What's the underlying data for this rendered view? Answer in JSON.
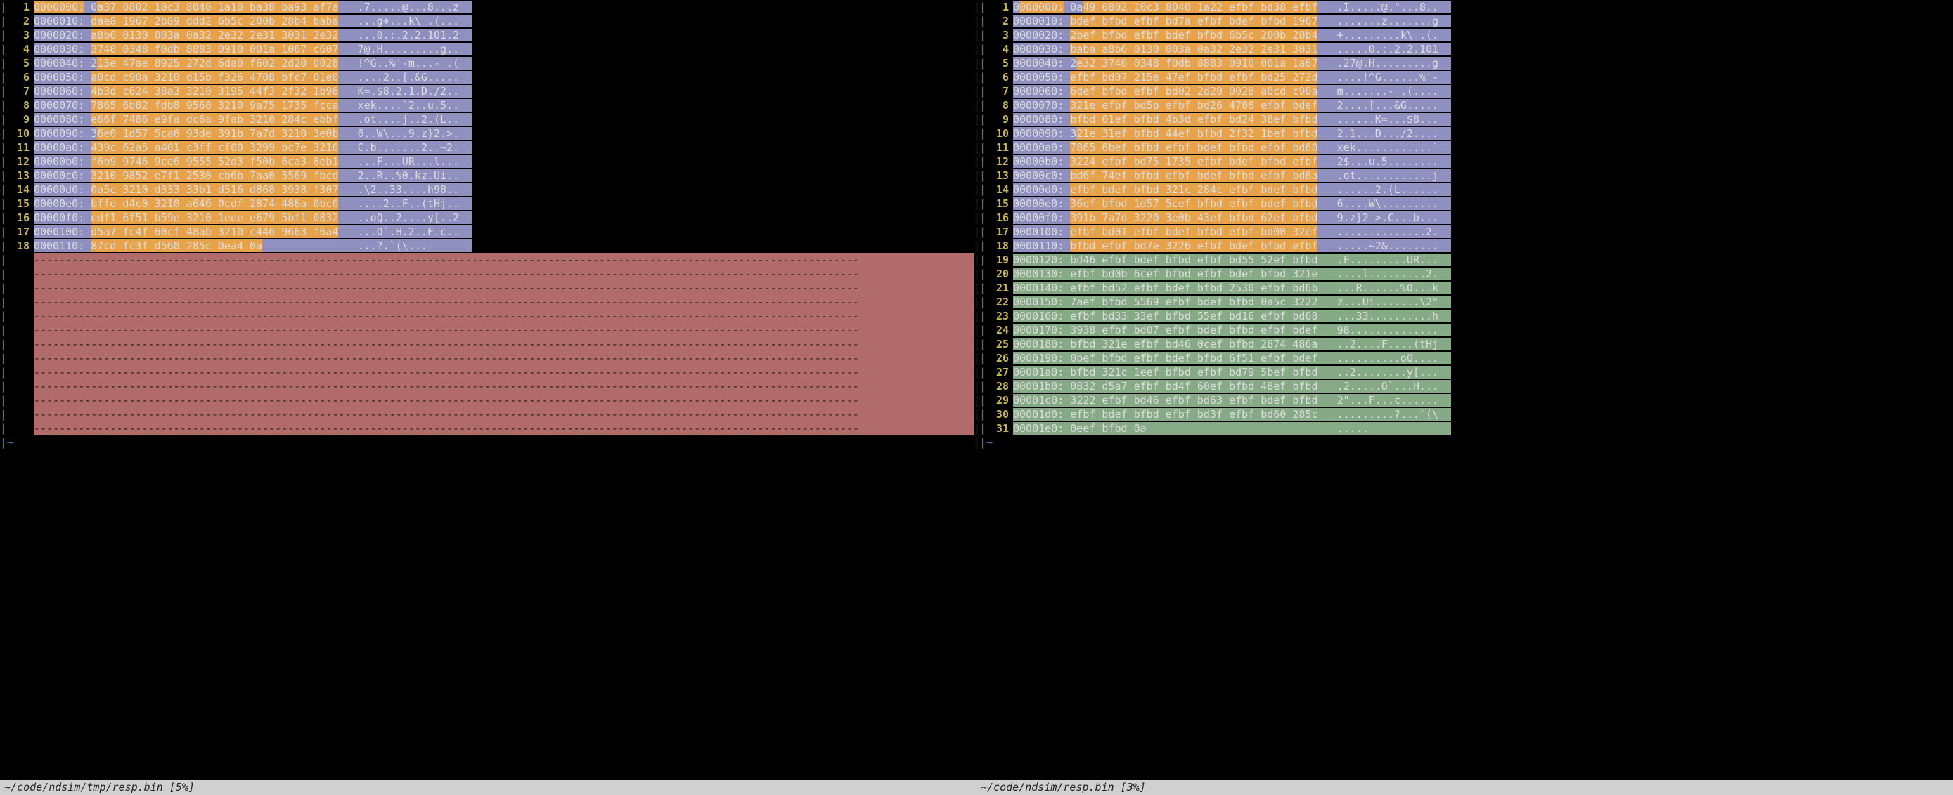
{
  "status": {
    "left": "~/code/ndsim/tmp/resp.bin [5%]",
    "right": "~/code/ndsim/resp.bin [3%]"
  },
  "left": {
    "rows": [
      {
        "n": 1,
        "addr": "0000000:",
        "hex": "0a37 0802 10c3 8040 1a10 ba38 ba93 af7a",
        "ascii": ".7.....@...8...z",
        "addrbg": "orange",
        "hexseg": [
          {
            "t": "0",
            "bg": "purple"
          },
          {
            "t": "a37 0802 10c3 8040 1a10 ba38 ba93 af7a",
            "bg": "orange"
          }
        ],
        "asciibg": "purple"
      },
      {
        "n": 2,
        "addr": "0000010:",
        "hex": "dae8 1967 2b89 ddd2 6b5c 200b 28b4 baba",
        "ascii": "...g+...k\\ .(...",
        "addrbg": "purple",
        "hexbg": "orange",
        "asciibg": "purple"
      },
      {
        "n": 3,
        "addr": "0000020:",
        "hex": "a8b6 0130 003a 0a32 2e32 2e31 3031 2e32",
        "ascii": "...0.:.2.2.101.2",
        "addrbg": "purple",
        "hexbg": "orange",
        "asciibg": "purple"
      },
      {
        "n": 4,
        "addr": "0000030:",
        "hex": "3740 0348 f0db 8883 0910 001a 1067 c607",
        "ascii": "7@.H.........g..",
        "addrbg": "purple",
        "hexbg": "orange",
        "asciibg": "purple"
      },
      {
        "n": 5,
        "addr": "0000040:",
        "hex": "215e 47ae 8925 272d 6da0 f602 2d20 0028",
        "ascii": "!^G..%'-m...- .(",
        "addrbg": "purple",
        "hexseg": [
          {
            "t": "2",
            "bg": "purple"
          },
          {
            "t": "15e 47ae 8925 272d 6da0 f602 2d20 0028",
            "bg": "orange"
          }
        ],
        "asciibg": "purple"
      },
      {
        "n": 6,
        "addr": "0000050:",
        "hex": "a0cd c90a 3210 d15b f326 4708 bfc7 01e0",
        "ascii": "....2..[.&G.....",
        "addrbg": "purple",
        "hexbg": "orange",
        "asciibg": "purple"
      },
      {
        "n": 7,
        "addr": "0000060:",
        "hex": "4b3d c624 38a3 3210 3195 44f3 2f32 1b96",
        "ascii": "K=.$8.2.1.D./2..",
        "addrbg": "purple",
        "hexbg": "orange",
        "asciibg": "purple"
      },
      {
        "n": 8,
        "addr": "0000070:",
        "hex": "7865 6b82 fdb8 9560 3210 9a75 1735 fcca",
        "ascii": "xek....`2..u.5..",
        "addrbg": "purple",
        "hexbg": "orange",
        "asciibg": "purple"
      },
      {
        "n": 9,
        "addr": "0000080:",
        "hex": "e66f 7486 e9fa dc6a 9fab 3210 284c ebbf",
        "ascii": ".ot....j..2.(L..",
        "addrbg": "purple",
        "hexbg": "orange",
        "asciibg": "purple"
      },
      {
        "n": 10,
        "addr": "0000090:",
        "hex": "36e0 1d57 5ca6 93de 391b 7a7d 3210 3e0b",
        "ascii": "6..W\\...9.z}2.>.",
        "addrbg": "purple",
        "hexseg": [
          {
            "t": "3",
            "bg": "purple"
          },
          {
            "t": "6e0 1d57 5ca6 93de 391b 7a7d 3210 3e0b",
            "bg": "orange"
          }
        ],
        "asciibg": "purple"
      },
      {
        "n": 11,
        "addr": "00000a0:",
        "hex": "439c 62a5 a401 c3ff cf00 3299 bc7e 3210",
        "ascii": "C.b.......2..~2.",
        "addrbg": "purple",
        "hexbg": "orange",
        "asciibg": "purple"
      },
      {
        "n": 12,
        "addr": "00000b0:",
        "hex": "f6b9 9746 9ce6 9555 52d3 f50b 6ca3 8eb1",
        "ascii": "...F...UR...l...",
        "addrbg": "purple",
        "hexbg": "orange",
        "asciibg": "purple"
      },
      {
        "n": 13,
        "addr": "00000c0:",
        "hex": "3210 9852 e7f1 2530 cb6b 7aa0 5569 fbcd",
        "ascii": "2..R..%0.kz.Ui..",
        "addrbg": "purple",
        "hexbg": "orange",
        "asciibg": "purple"
      },
      {
        "n": 14,
        "addr": "00000d0:",
        "hex": "0a5c 3210 d333 33b1 d516 d868 3938 f307",
        "ascii": ".\\2..33....h98..",
        "addrbg": "purple",
        "hexbg": "orange",
        "asciibg": "purple"
      },
      {
        "n": 15,
        "addr": "00000e0:",
        "hex": "bffe d4c0 3210 a646 0cdf 2874 486a 0bc0",
        "ascii": "....2..F..(tHj..",
        "addrbg": "purple",
        "hexbg": "orange",
        "asciibg": "purple"
      },
      {
        "n": 16,
        "addr": "00000f0:",
        "hex": "edf1 6f51 b59e 3210 1eee e679 5bf1 0832",
        "ascii": "..oQ..2....y[..2",
        "addrbg": "purple",
        "hexbg": "orange",
        "asciibg": "purple"
      },
      {
        "n": 17,
        "addr": "0000100:",
        "hex": "d5a7 fc4f 60cf 48ab 3210 c446 9663 f6a4",
        "ascii": "...O`.H.2..F.c..",
        "addrbg": "purple",
        "hexbg": "orange",
        "asciibg": "purple"
      },
      {
        "n": 18,
        "addr": "0000110:",
        "hex": "87cd fc3f d560 285c 0ea4 0a",
        "ascii": "...?.`(\\...",
        "addrbg": "purple",
        "hexbg": "orange",
        "asciibg": "purple"
      }
    ],
    "fillerCount": 13
  },
  "right": {
    "rows": [
      {
        "n": 1,
        "addr": "0000000:",
        "hex": "0a49 0802 10c3 8040 1a22 efbf bd38 efbf",
        "ascii": ".I.....@.\"...8..",
        "addrseg": [
          {
            "t": "0",
            "bg": "purple"
          },
          {
            "t": "000000:",
            "bg": "orange"
          }
        ],
        "hexseg": [
          {
            "t": "0a",
            "bg": "purple"
          },
          {
            "t": "49 0802 10c3 8040 1a22 efbf bd38 efbf",
            "bg": "orange"
          }
        ],
        "asciibg": "purple"
      },
      {
        "n": 2,
        "addr": "0000010:",
        "hex": "bdef bfbd efbf bd7a efbf bdef bfbd 1967",
        "ascii": ".......z.......g",
        "addrbg": "purple",
        "hexbg": "orange",
        "asciibg": "purple"
      },
      {
        "n": 3,
        "addr": "0000020:",
        "hex": "2bef bfbd efbf bdef bfbd 6b5c 200b 28b4",
        "ascii": "+.........k\\ .(.",
        "addrbg": "purple",
        "hexbg": "orange",
        "asciibg": "purple"
      },
      {
        "n": 4,
        "addr": "0000030:",
        "hex": "baba a8b6 0130 003a 0a32 2e32 2e31 3031",
        "ascii": ".....0.:.2.2.101",
        "addrbg": "purple",
        "hexbg": "orange",
        "asciibg": "purple"
      },
      {
        "n": 5,
        "addr": "0000040:",
        "hex": "2e32 3740 0348 f0db 8883 0910 001a 1a67",
        "ascii": ".27@.H.........g",
        "addrbg": "purple",
        "hexseg": [
          {
            "t": "2",
            "bg": "purple"
          },
          {
            "t": "e32 3740 0348 f0db 8883 0910 001a 1a67",
            "bg": "orange"
          }
        ],
        "asciibg": "purple"
      },
      {
        "n": 6,
        "addr": "0000050:",
        "hex": "efbf bd07 215e 47ef bfbd efbf bd25 272d",
        "ascii": "....!^G......%'-",
        "addrbg": "purple",
        "hexbg": "orange",
        "asciibg": "purple"
      },
      {
        "n": 7,
        "addr": "0000060:",
        "hex": "6def bfbd efbf bd02 2d20 0028 a0cd c90a",
        "ascii": "m.......- .(....",
        "addrbg": "purple",
        "hexbg": "orange",
        "asciibg": "purple"
      },
      {
        "n": 8,
        "addr": "0000070:",
        "hex": "321e efbf bd5b efbf bd26 4708 efbf bdef",
        "ascii": "2....[...&G.....",
        "addrbg": "purple",
        "hexbg": "orange",
        "asciibg": "purple"
      },
      {
        "n": 9,
        "addr": "0000080:",
        "hex": "bfbd 01ef bfbd 4b3d efbf bd24 38ef bfbd",
        "ascii": "......K=...$8...",
        "addrbg": "purple",
        "hexbg": "orange",
        "asciibg": "purple"
      },
      {
        "n": 10,
        "addr": "0000090:",
        "hex": "321e 31ef bfbd 44ef bfbd 2f32 1bef bfbd",
        "ascii": "2.1...D.../2....",
        "addrbg": "purple",
        "hexseg": [
          {
            "t": "3",
            "bg": "purple"
          },
          {
            "t": "21e 31ef bfbd 44ef bfbd 2f32 1bef bfbd",
            "bg": "orange"
          }
        ],
        "asciibg": "purple"
      },
      {
        "n": 11,
        "addr": "00000a0:",
        "hex": "7865 6bef bfbd efbf bdef bfbd efbf bd60",
        "ascii": "xek............`",
        "addrbg": "purple",
        "hexbg": "orange",
        "asciibg": "purple"
      },
      {
        "n": 12,
        "addr": "00000b0:",
        "hex": "3224 efbf bd75 1735 efbf bdef bfbd efbf",
        "ascii": "2$...u.5........",
        "addrbg": "purple",
        "hexbg": "orange",
        "asciibg": "purple"
      },
      {
        "n": 13,
        "addr": "00000c0:",
        "hex": "bd6f 74ef bfbd efbf bdef bfbd efbf bd6a",
        "ascii": ".ot............j",
        "addrbg": "purple",
        "hexbg": "orange",
        "asciibg": "purple"
      },
      {
        "n": 14,
        "addr": "00000d0:",
        "hex": "efbf bdef bfbd 321c 284c efbf bdef bfbd",
        "ascii": "......2.(L......",
        "addrbg": "purple",
        "hexbg": "orange",
        "asciibg": "purple"
      },
      {
        "n": 15,
        "addr": "00000e0:",
        "hex": "36ef bfbd 1d57 5cef bfbd efbf bdef bfbd",
        "ascii": "6....W\\.........",
        "addrbg": "purple",
        "hexbg": "orange",
        "asciibg": "purple"
      },
      {
        "n": 16,
        "addr": "00000f0:",
        "hex": "391b 7a7d 3220 3e0b 43ef bfbd 62ef bfbd",
        "ascii": "9.z}2 >.C...b...",
        "addrbg": "purple",
        "hexbg": "orange",
        "asciibg": "purple"
      },
      {
        "n": 17,
        "addr": "0000100:",
        "hex": "efbf bd01 efbf bdef bfbd efbf bd00 32ef",
        "ascii": "..............2.",
        "addrbg": "purple",
        "hexbg": "orange",
        "asciibg": "purple"
      },
      {
        "n": 18,
        "addr": "0000110:",
        "hex": "bfbd efbf bd7e 3226 efbf bdef bfbd efbf",
        "ascii": ".....~2&........",
        "addrbg": "purple",
        "hexbg": "orange",
        "asciibg": "purple"
      },
      {
        "n": 19,
        "addr": "0000120:",
        "hex": "bd46 efbf bdef bfbd efbf bd55 52ef bfbd",
        "ascii": ".F.........UR...",
        "addrbg": "green",
        "hexbg": "green",
        "asciibg": "green"
      },
      {
        "n": 20,
        "addr": "0000130:",
        "hex": "efbf bd0b 6cef bfbd efbf bdef bfbd 321e",
        "ascii": "....l.........2.",
        "addrbg": "green",
        "hexbg": "green",
        "asciibg": "green"
      },
      {
        "n": 21,
        "addr": "0000140:",
        "hex": "efbf bd52 efbf bdef bfbd 2530 efbf bd6b",
        "ascii": "...R......%0...k",
        "addrbg": "green",
        "hexbg": "green",
        "asciibg": "green"
      },
      {
        "n": 22,
        "addr": "0000150:",
        "hex": "7aef bfbd 5569 efbf bdef bfbd 0a5c 3222",
        "ascii": "z...Ui.......\\2\"",
        "addrbg": "green",
        "hexbg": "green",
        "asciibg": "green"
      },
      {
        "n": 23,
        "addr": "0000160:",
        "hex": "efbf bd33 33ef bfbd 55ef bd16 efbf bd68",
        "ascii": "...33..........h",
        "addrbg": "green",
        "hexbg": "green",
        "asciibg": "green"
      },
      {
        "n": 24,
        "addr": "0000170:",
        "hex": "3938 efbf bd07 efbf bdef bfbd efbf bdef",
        "ascii": "98..............",
        "addrbg": "green",
        "hexbg": "green",
        "asciibg": "green"
      },
      {
        "n": 25,
        "addr": "0000180:",
        "hex": "bfbd 321e efbf bd46 0cef bfbd 2874 486a",
        "ascii": "..2....F....(tHj",
        "addrbg": "green",
        "hexbg": "green",
        "asciibg": "green"
      },
      {
        "n": 26,
        "addr": "0000190:",
        "hex": "0bef bfbd efbf bdef bfbd 6f51 efbf bdef",
        "ascii": "..........oQ....",
        "addrbg": "green",
        "hexbg": "green",
        "asciibg": "green"
      },
      {
        "n": 27,
        "addr": "00001a0:",
        "hex": "bfbd 321c 1eef bfbd efbf bd79 5bef bfbd",
        "ascii": "..2........y[...",
        "addrbg": "green",
        "hexbg": "green",
        "asciibg": "green"
      },
      {
        "n": 28,
        "addr": "00001b0:",
        "hex": "0832 d5a7 efbf bd4f 60ef bfbd 48ef bfbd",
        "ascii": ".2.....O`...H...",
        "addrbg": "green",
        "hexbg": "green",
        "asciibg": "green"
      },
      {
        "n": 29,
        "addr": "00001c0:",
        "hex": "3222 efbf bd46 efbf bd63 efbf bdef bfbd",
        "ascii": "2\"...F...c......",
        "addrbg": "green",
        "hexbg": "green",
        "asciibg": "green"
      },
      {
        "n": 30,
        "addr": "00001d0:",
        "hex": "efbf bdef bfbd efbf bd3f efbf bd60 285c",
        "ascii": ".........?...`(\\",
        "addrbg": "green",
        "hexbg": "green",
        "asciibg": "green"
      },
      {
        "n": 31,
        "addr": "00001e0:",
        "hex": "0eef bfbd 0a",
        "ascii": ".....",
        "addrbg": "green",
        "hexbg": "green",
        "asciibg": "green"
      }
    ]
  }
}
